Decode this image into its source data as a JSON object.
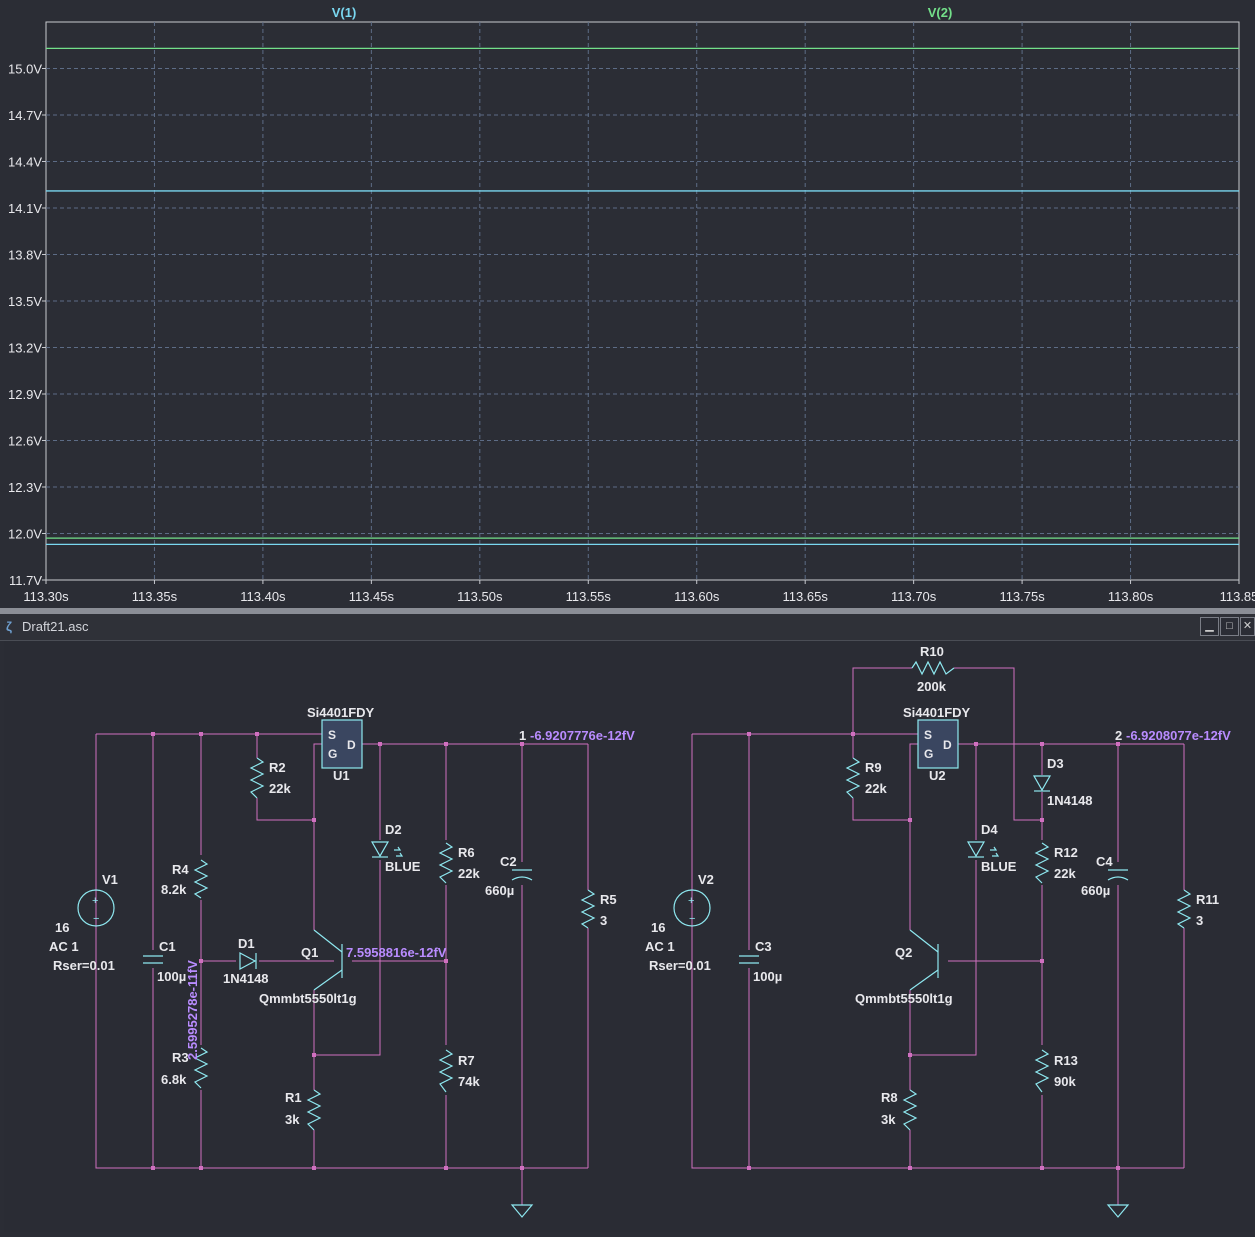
{
  "chart_data": {
    "type": "line",
    "series": [
      {
        "name": "V(1)",
        "color": "#7ad7f0",
        "segments": [
          {
            "x": [
              113.3,
              113.85
            ],
            "y": [
              14.21,
              14.21
            ]
          },
          {
            "x": [
              113.3,
              113.85
            ],
            "y": [
              11.93,
              11.93
            ]
          }
        ]
      },
      {
        "name": "V(2)",
        "color": "#73e08a",
        "segments": [
          {
            "x": [
              113.3,
              113.85
            ],
            "y": [
              15.13,
              15.13
            ]
          },
          {
            "x": [
              113.3,
              113.85
            ],
            "y": [
              11.97,
              11.97
            ]
          }
        ]
      }
    ],
    "xlim": [
      113.3,
      113.85
    ],
    "ylim": [
      11.7,
      15.3
    ],
    "xticks": [
      113.3,
      113.35,
      113.4,
      113.45,
      113.5,
      113.55,
      113.6,
      113.65,
      113.7,
      113.75,
      113.8,
      113.85
    ],
    "xtick_labels": [
      "113.30s",
      "113.35s",
      "113.40s",
      "113.45s",
      "113.50s",
      "113.55s",
      "113.60s",
      "113.65s",
      "113.70s",
      "113.75s",
      "113.80s",
      "113.85"
    ],
    "yticks": [
      15.0,
      14.7,
      14.4,
      14.1,
      13.8,
      13.5,
      13.2,
      12.9,
      12.6,
      12.3,
      12.0,
      11.7
    ],
    "ytick_labels": [
      "15.0V",
      "14.7V",
      "14.4V",
      "14.1V",
      "13.8V",
      "13.5V",
      "13.2V",
      "12.9V",
      "12.6V",
      "12.3V",
      "12.0V",
      "11.7V"
    ],
    "grid": true
  },
  "window": {
    "title": "Draft21.asc",
    "min_icon": "minimize-icon",
    "max_icon": "maximize-icon",
    "close_icon": "close-icon"
  },
  "colors": {
    "background": "#2b2d35",
    "grid": "#5d6c86",
    "axis": "#c8cad0",
    "wire": "#d070c0",
    "component": "#8ee8f0",
    "text": "#e8e8ec",
    "voltage_label": "#b98cff"
  },
  "schematic": {
    "labels": {
      "U1_model": "Si4401FDY",
      "U1": "U1",
      "U2_model": "Si4401FDY",
      "U2": "U2",
      "S": "S",
      "G": "G",
      "D": "D",
      "R2": "R2",
      "R2v": "22k",
      "R4": "R4",
      "R4v": "8.2k",
      "R3": "R3",
      "R3v": "6.8k",
      "R1": "R1",
      "R1v": "3k",
      "R6": "R6",
      "R6v": "22k",
      "R7": "R7",
      "R7v": "74k",
      "R5": "R5",
      "R5v": "3",
      "C1": "C1",
      "C1v": "100µ",
      "C2": "C2",
      "C2v": "660µ",
      "D1": "D1",
      "D1v": "1N4148",
      "D2": "D2",
      "D2v": "BLUE",
      "Q1": "Q1",
      "Q1v": "Qmmbt5550lt1g",
      "V1": "V1",
      "V1v": "16",
      "V1ac": "AC 1",
      "V1r": "Rser=0.01",
      "node1": "1",
      "node1v": "-6.9207776e-12fV",
      "q1v": "7.5958816e-12fV",
      "n3v": "2.5995278e-11fV",
      "R10": "R10",
      "R10v": "200k",
      "R9": "R9",
      "R9v": "22k",
      "D3": "D3",
      "D3v": "1N4148",
      "D4": "D4",
      "D4v": "BLUE",
      "R12": "R12",
      "R12v": "22k",
      "C4": "C4",
      "C4v": "660µ",
      "R11": "R11",
      "R11v": "3",
      "V2": "V2",
      "V2v": "16",
      "V2ac": "AC 1",
      "V2r": "Rser=0.01",
      "C3": "C3",
      "C3v": "100µ",
      "Q2": "Q2",
      "Q2v": "Qmmbt5550lt1g",
      "R13": "R13",
      "R13v": "90k",
      "R8": "R8",
      "R8v": "3k",
      "node2": "2",
      "node2v": "-6.9208077e-12fV"
    }
  }
}
